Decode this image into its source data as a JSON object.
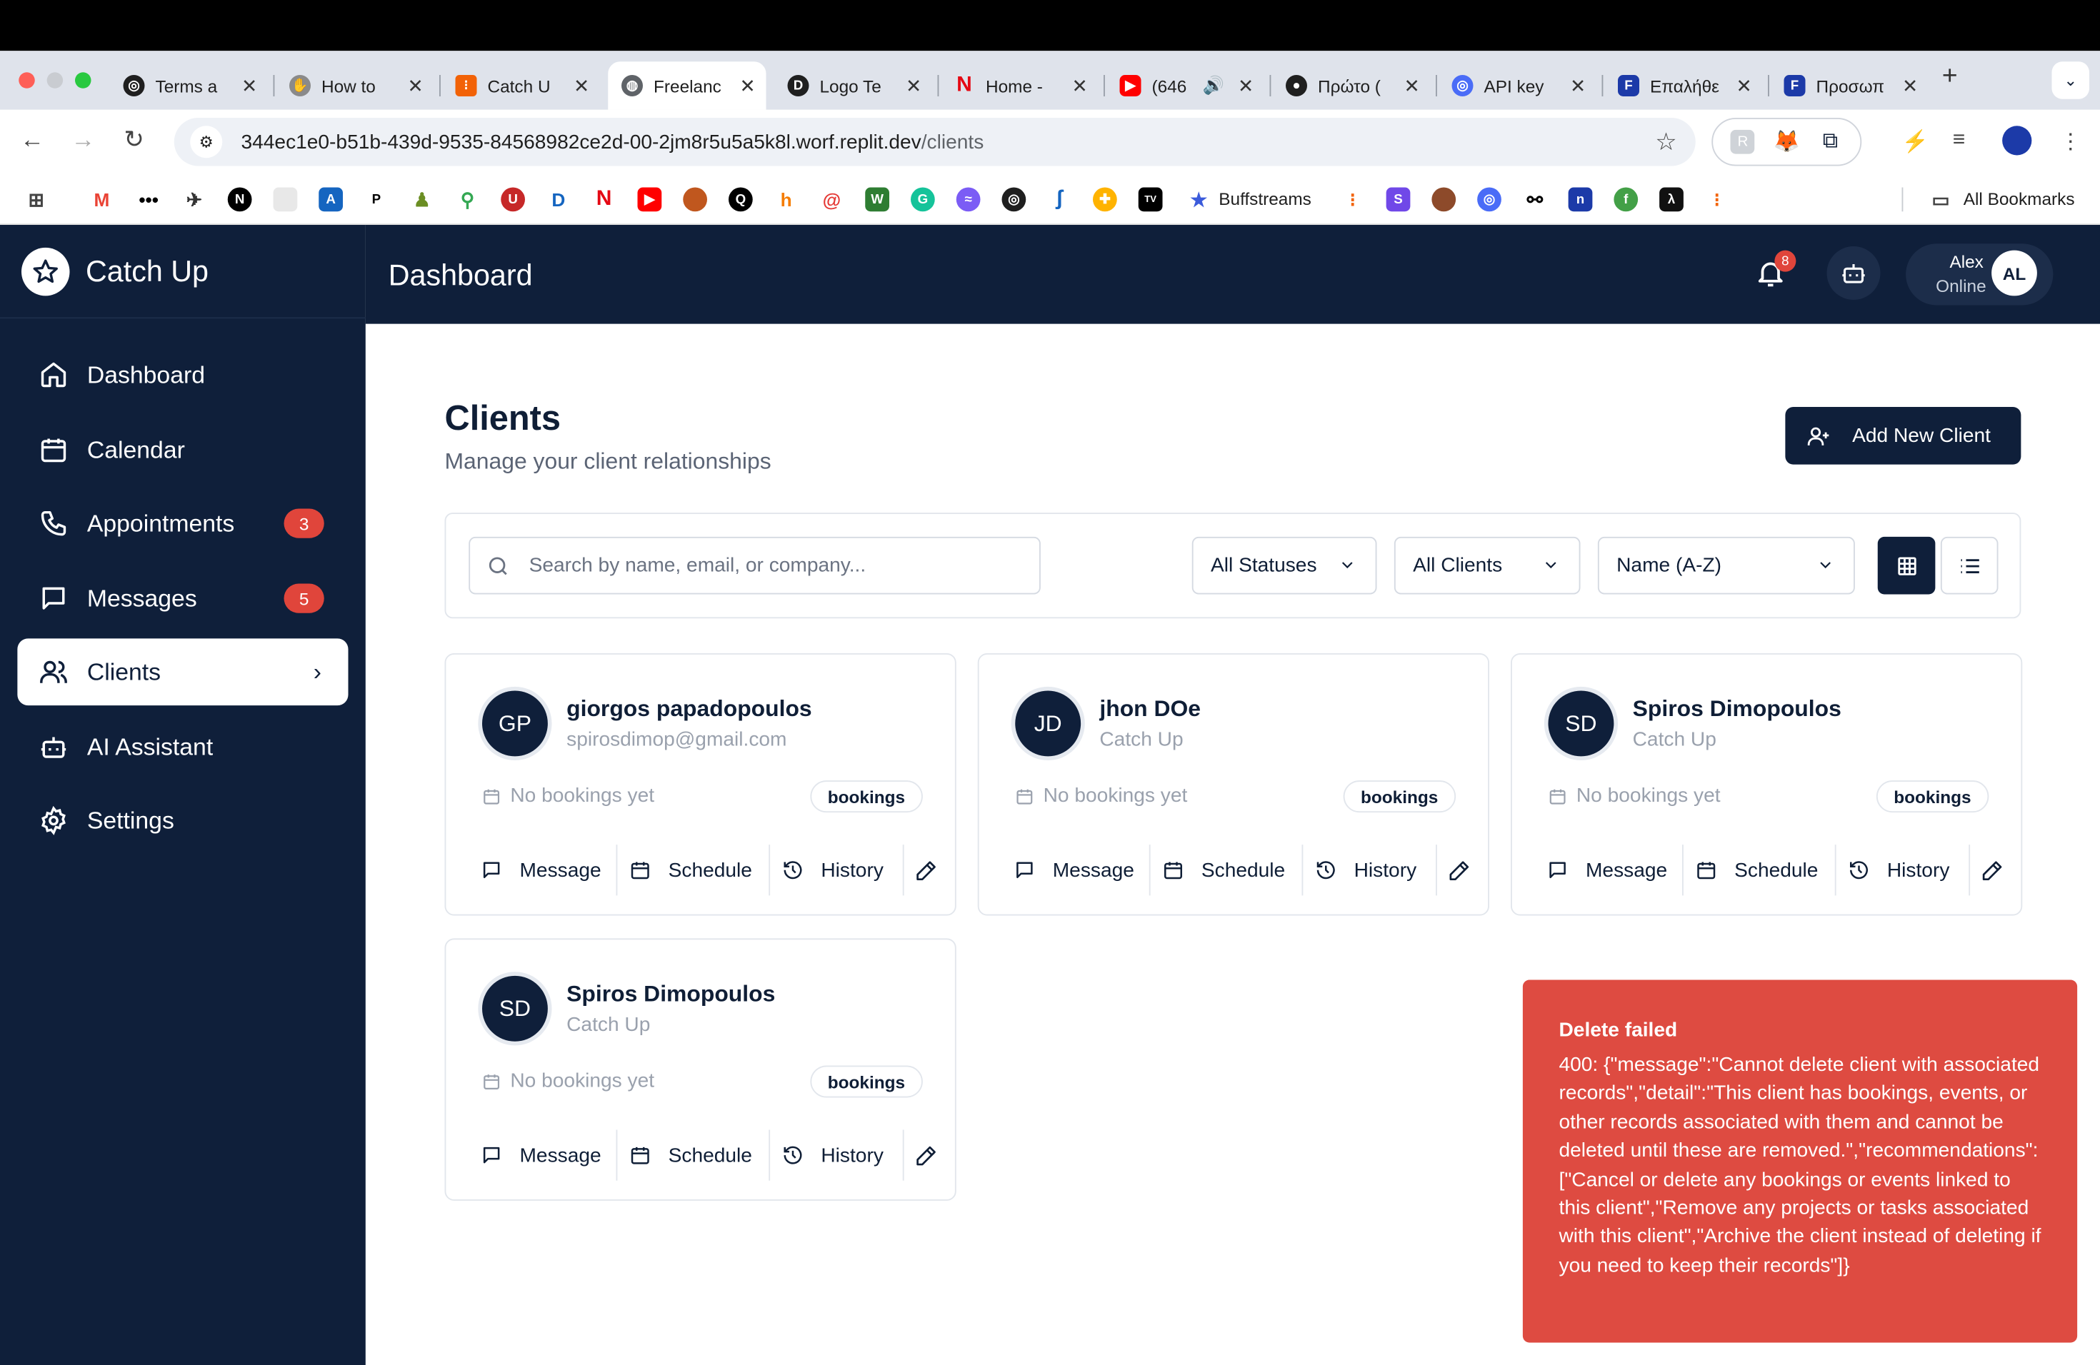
{
  "browser": {
    "tabs": [
      {
        "title": "Terms a",
        "icon": "openai-icon",
        "color": "#1f1f1f"
      },
      {
        "title": "How to",
        "icon": "hand-icon",
        "color": "#8a8a8a"
      },
      {
        "title": "Catch U",
        "icon": "replit-icon",
        "color": "#f26207"
      },
      {
        "title": "Freelanc",
        "icon": "globe-icon",
        "color": "#5f6368"
      },
      {
        "title": "Logo Te",
        "icon": "logo-icon",
        "color": "#1f1f1f"
      },
      {
        "title": "Home -",
        "icon": "netflix-icon",
        "color": "#e50914"
      },
      {
        "title": "(646",
        "icon": "youtube-icon",
        "color": "#ff0000"
      },
      {
        "title": "Πρώτο (",
        "icon": "github-icon",
        "color": "#1f1f1f"
      },
      {
        "title": "API key",
        "icon": "api-icon",
        "color": "#4a6cf7"
      },
      {
        "title": "Επαλήθε",
        "icon": "f-icon",
        "color": "#1c3aa8"
      },
      {
        "title": "Προσωπ",
        "icon": "f-icon",
        "color": "#1c3aa8"
      }
    ],
    "url_main": "344ec1e0-b51b-439d-9535-84568982ce2d-00-2jm8r5u5a5k8l.worf.replit.dev",
    "url_path": "/clients",
    "bookmarks_label": "Buffstreams",
    "all_bookmarks": "All Bookmarks"
  },
  "app": {
    "name": "Catch Up",
    "nav": [
      {
        "label": "Dashboard",
        "icon": "home-icon"
      },
      {
        "label": "Calendar",
        "icon": "calendar-icon"
      },
      {
        "label": "Appointments",
        "icon": "phone-icon",
        "badge": "3"
      },
      {
        "label": "Messages",
        "icon": "message-icon",
        "badge": "5"
      },
      {
        "label": "Clients",
        "icon": "users-icon",
        "active": true
      },
      {
        "label": "AI Assistant",
        "icon": "bot-icon"
      },
      {
        "label": "Settings",
        "icon": "gear-icon"
      }
    ],
    "header_title": "Dashboard",
    "notifications": "8",
    "user": {
      "name": "Alex",
      "status": "Online",
      "initials": "AL"
    }
  },
  "page": {
    "title": "Clients",
    "subtitle": "Manage your client relationships",
    "add_button": "Add New Client",
    "search_placeholder": "Search by name, email, or company...",
    "filter_status": "All Statuses",
    "filter_clients": "All Clients",
    "sort": "Name (A-Z)"
  },
  "clients": [
    {
      "initials": "GP",
      "name": "giorgos papadopoulos",
      "sub": "spirosdimop@gmail.com",
      "bookings": "No bookings yet",
      "tag": "bookings"
    },
    {
      "initials": "JD",
      "name": "jhon DOe",
      "sub": "Catch Up",
      "bookings": "No bookings yet",
      "tag": "bookings"
    },
    {
      "initials": "SD",
      "name": "Spiros Dimopoulos",
      "sub": "Catch Up",
      "bookings": "No bookings yet",
      "tag": "bookings"
    },
    {
      "initials": "SD",
      "name": "Spiros Dimopoulos",
      "sub": "Catch Up",
      "bookings": "No bookings yet",
      "tag": "bookings"
    }
  ],
  "card_actions": {
    "message": "Message",
    "schedule": "Schedule",
    "history": "History"
  },
  "toast": {
    "title": "Delete failed",
    "body": "400: {\"message\":\"Cannot delete client with associated records\",\"detail\":\"This client has bookings, events, or other records associated with them and cannot be deleted until these are removed.\",\"recommendations\":[\"Cancel or delete any bookings or events linked to this client\",\"Remove any projects or tasks associated with this client\",\"Archive the client instead of deleting if you need to keep their records\"]}"
  },
  "colors": {
    "navy": "#0f1f3a",
    "danger": "#de4b41",
    "badge": "#e0453b"
  }
}
